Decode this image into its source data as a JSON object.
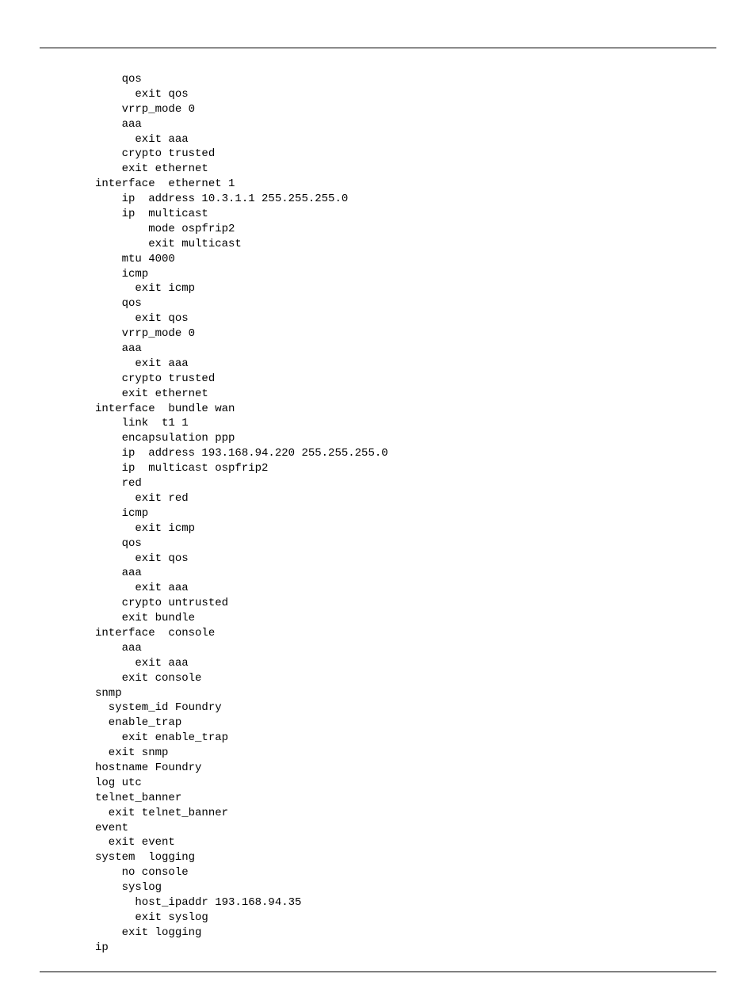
{
  "code": "    qos\n      exit qos\n    vrrp_mode 0\n    aaa\n      exit aaa\n    crypto trusted\n    exit ethernet\ninterface  ethernet 1\n    ip  address 10.3.1.1 255.255.255.0\n    ip  multicast\n        mode ospfrip2\n        exit multicast\n    mtu 4000\n    icmp\n      exit icmp\n    qos\n      exit qos\n    vrrp_mode 0\n    aaa\n      exit aaa\n    crypto trusted\n    exit ethernet\ninterface  bundle wan\n    link  t1 1\n    encapsulation ppp\n    ip  address 193.168.94.220 255.255.255.0\n    ip  multicast ospfrip2\n    red\n      exit red\n    icmp\n      exit icmp\n    qos\n      exit qos\n    aaa\n      exit aaa\n    crypto untrusted\n    exit bundle\ninterface  console\n    aaa\n      exit aaa\n    exit console\nsnmp\n  system_id Foundry\n  enable_trap\n    exit enable_trap\n  exit snmp\nhostname Foundry\nlog utc\ntelnet_banner\n  exit telnet_banner\nevent\n  exit event\nsystem  logging\n    no console\n    syslog\n      host_ipaddr 193.168.94.35\n      exit syslog\n    exit logging\nip"
}
